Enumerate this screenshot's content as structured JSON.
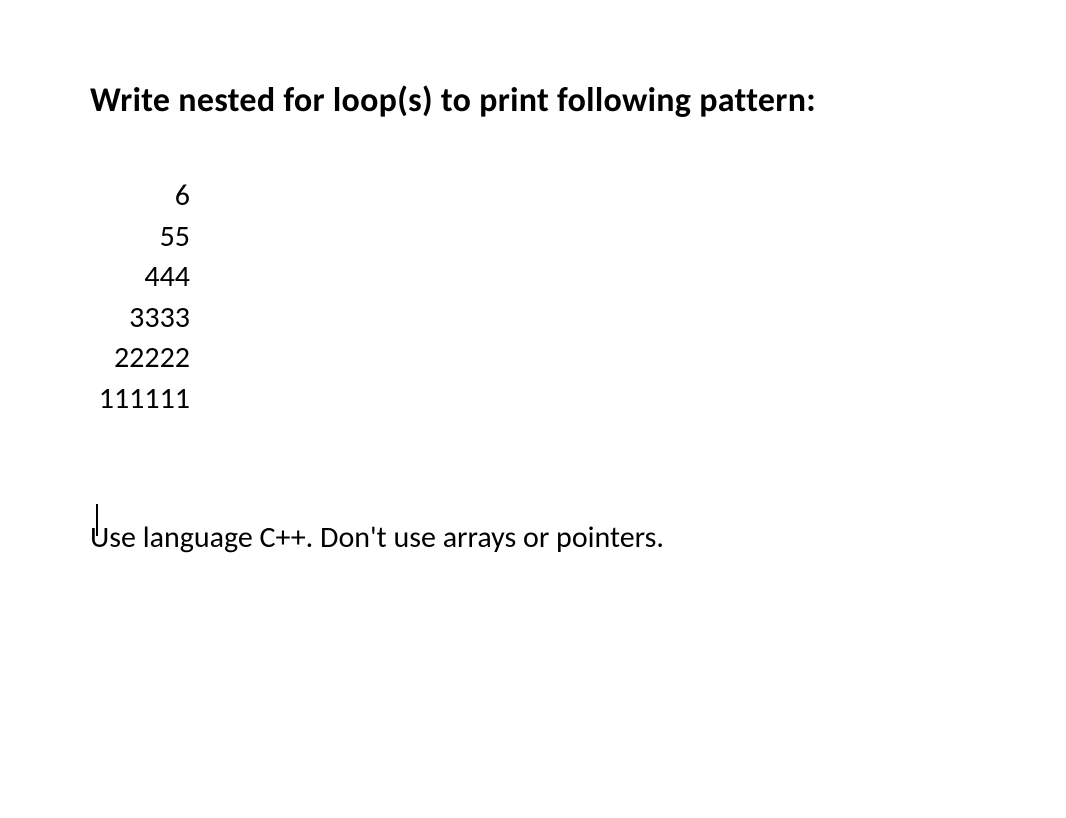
{
  "heading": "Write nested for loop(s) to print following pattern:",
  "pattern": {
    "lines": [
      "6",
      "55",
      "444",
      "3333",
      "22222",
      "111111"
    ]
  },
  "instruction": "Use language C++. Don't use arrays or pointers."
}
